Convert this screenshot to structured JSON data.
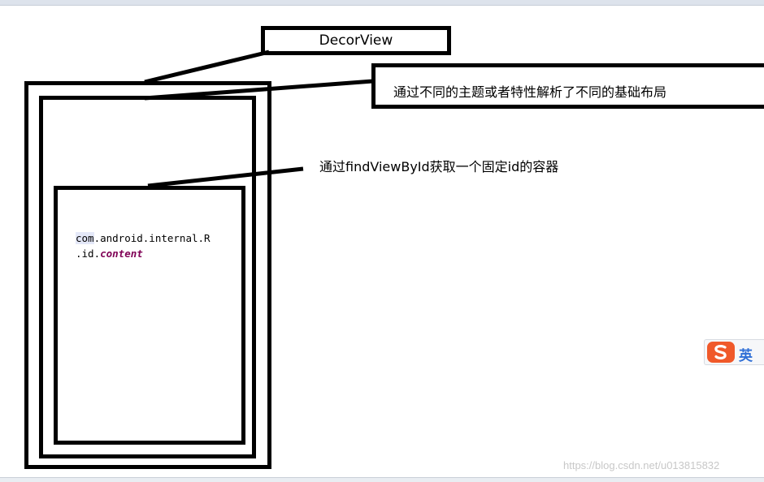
{
  "diagram": {
    "decor_label": "DecorView",
    "theme_note": "通过不同的主题或者特性解析了不同的基础布局",
    "findview_note": "通过findViewById获取一个固定id的容器",
    "code": {
      "line1_prefix": "com",
      "line1_rest": ".android.internal.R",
      "line2_prefix": ".id.",
      "line2_field": "content"
    }
  },
  "watermark": "https://blog.csdn.net/u013815832",
  "ime": {
    "logo_icon": "sogou-s-icon",
    "mode_label": "英",
    "colors": {
      "logo": "#f0592a",
      "mode": "#2f6fd6"
    }
  }
}
